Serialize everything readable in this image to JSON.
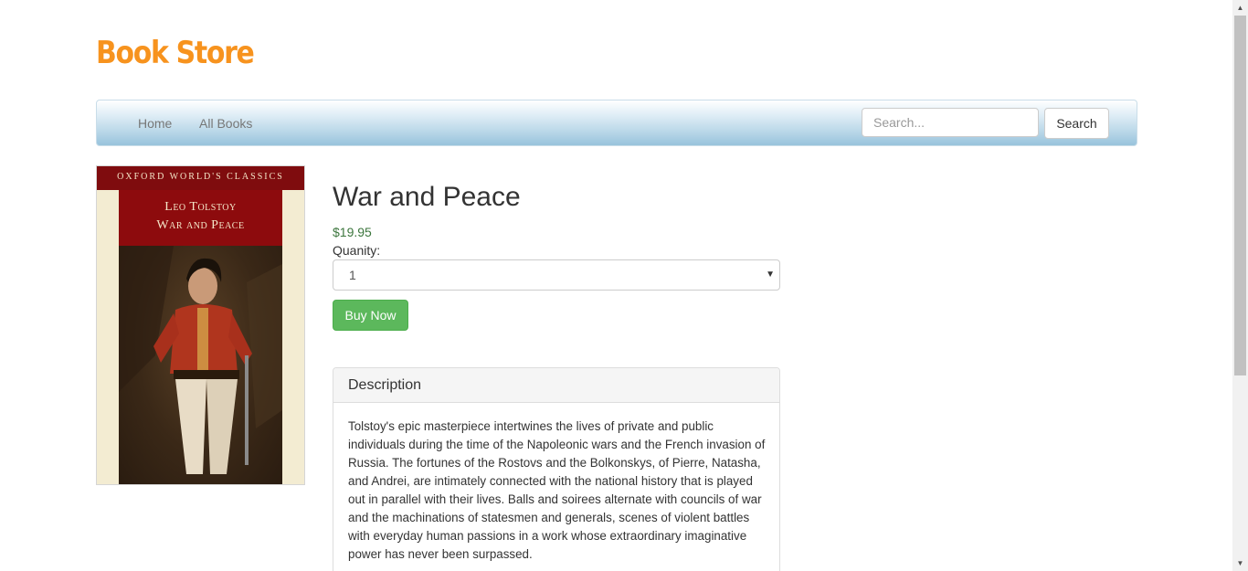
{
  "header": {
    "brand": "Book Store"
  },
  "nav": {
    "items": [
      {
        "label": "Home"
      },
      {
        "label": "All Books"
      }
    ],
    "search": {
      "placeholder": "Search...",
      "value": "",
      "button_label": "Search"
    }
  },
  "book": {
    "cover": {
      "series": "OXFORD WORLD'S CLASSICS",
      "author": "Leo Tolstoy",
      "title": "War and Peace"
    },
    "title": "War and Peace",
    "price": "$19.95",
    "quantity_label": "Quanity:",
    "quantity_selected": "1",
    "buy_label": "Buy Now",
    "description_heading": "Description",
    "description": "Tolstoy's epic masterpiece intertwines the lives of private and public individuals during the time of the Napoleonic wars and the French invasion of Russia. The fortunes of the Rostovs and the Bolkonskys, of Pierre, Natasha, and Andrei, are intimately connected with the national history that is played out in parallel with their lives. Balls and soirees alternate with councils of war and the machinations of statesmen and generals, scenes of violent battles with everyday human passions in a work whose extraordinary imaginative power has never been surpassed."
  },
  "colors": {
    "brand": "#f7931e",
    "price": "#3c763d",
    "buy_button": "#5cb85c",
    "cover_red": "#8d0b0d"
  },
  "icons": {
    "select_caret": "caret-down-icon",
    "scroll_up": "arrow-up-icon",
    "scroll_down": "arrow-down-icon"
  }
}
